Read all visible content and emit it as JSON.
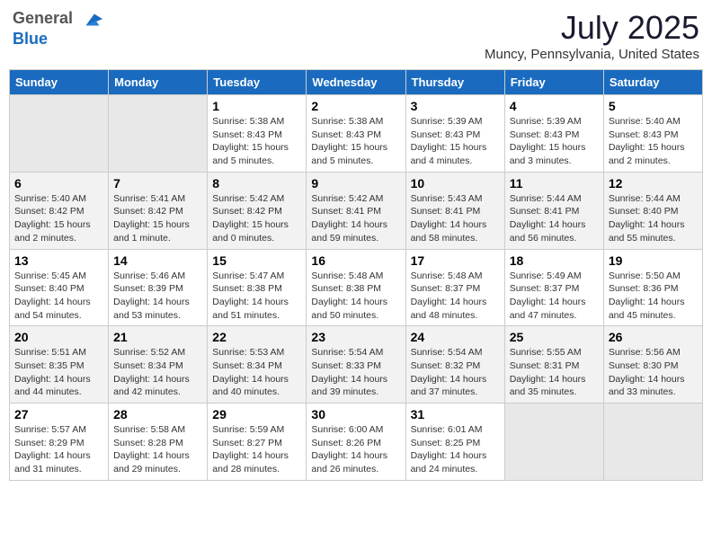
{
  "logo": {
    "general": "General",
    "blue": "Blue"
  },
  "title": {
    "month_year": "July 2025",
    "location": "Muncy, Pennsylvania, United States"
  },
  "headers": [
    "Sunday",
    "Monday",
    "Tuesday",
    "Wednesday",
    "Thursday",
    "Friday",
    "Saturday"
  ],
  "weeks": [
    [
      {
        "day": "",
        "info": ""
      },
      {
        "day": "",
        "info": ""
      },
      {
        "day": "1",
        "info": "Sunrise: 5:38 AM\nSunset: 8:43 PM\nDaylight: 15 hours\nand 5 minutes."
      },
      {
        "day": "2",
        "info": "Sunrise: 5:38 AM\nSunset: 8:43 PM\nDaylight: 15 hours\nand 5 minutes."
      },
      {
        "day": "3",
        "info": "Sunrise: 5:39 AM\nSunset: 8:43 PM\nDaylight: 15 hours\nand 4 minutes."
      },
      {
        "day": "4",
        "info": "Sunrise: 5:39 AM\nSunset: 8:43 PM\nDaylight: 15 hours\nand 3 minutes."
      },
      {
        "day": "5",
        "info": "Sunrise: 5:40 AM\nSunset: 8:43 PM\nDaylight: 15 hours\nand 2 minutes."
      }
    ],
    [
      {
        "day": "6",
        "info": "Sunrise: 5:40 AM\nSunset: 8:42 PM\nDaylight: 15 hours\nand 2 minutes."
      },
      {
        "day": "7",
        "info": "Sunrise: 5:41 AM\nSunset: 8:42 PM\nDaylight: 15 hours\nand 1 minute."
      },
      {
        "day": "8",
        "info": "Sunrise: 5:42 AM\nSunset: 8:42 PM\nDaylight: 15 hours\nand 0 minutes."
      },
      {
        "day": "9",
        "info": "Sunrise: 5:42 AM\nSunset: 8:41 PM\nDaylight: 14 hours\nand 59 minutes."
      },
      {
        "day": "10",
        "info": "Sunrise: 5:43 AM\nSunset: 8:41 PM\nDaylight: 14 hours\nand 58 minutes."
      },
      {
        "day": "11",
        "info": "Sunrise: 5:44 AM\nSunset: 8:41 PM\nDaylight: 14 hours\nand 56 minutes."
      },
      {
        "day": "12",
        "info": "Sunrise: 5:44 AM\nSunset: 8:40 PM\nDaylight: 14 hours\nand 55 minutes."
      }
    ],
    [
      {
        "day": "13",
        "info": "Sunrise: 5:45 AM\nSunset: 8:40 PM\nDaylight: 14 hours\nand 54 minutes."
      },
      {
        "day": "14",
        "info": "Sunrise: 5:46 AM\nSunset: 8:39 PM\nDaylight: 14 hours\nand 53 minutes."
      },
      {
        "day": "15",
        "info": "Sunrise: 5:47 AM\nSunset: 8:38 PM\nDaylight: 14 hours\nand 51 minutes."
      },
      {
        "day": "16",
        "info": "Sunrise: 5:48 AM\nSunset: 8:38 PM\nDaylight: 14 hours\nand 50 minutes."
      },
      {
        "day": "17",
        "info": "Sunrise: 5:48 AM\nSunset: 8:37 PM\nDaylight: 14 hours\nand 48 minutes."
      },
      {
        "day": "18",
        "info": "Sunrise: 5:49 AM\nSunset: 8:37 PM\nDaylight: 14 hours\nand 47 minutes."
      },
      {
        "day": "19",
        "info": "Sunrise: 5:50 AM\nSunset: 8:36 PM\nDaylight: 14 hours\nand 45 minutes."
      }
    ],
    [
      {
        "day": "20",
        "info": "Sunrise: 5:51 AM\nSunset: 8:35 PM\nDaylight: 14 hours\nand 44 minutes."
      },
      {
        "day": "21",
        "info": "Sunrise: 5:52 AM\nSunset: 8:34 PM\nDaylight: 14 hours\nand 42 minutes."
      },
      {
        "day": "22",
        "info": "Sunrise: 5:53 AM\nSunset: 8:34 PM\nDaylight: 14 hours\nand 40 minutes."
      },
      {
        "day": "23",
        "info": "Sunrise: 5:54 AM\nSunset: 8:33 PM\nDaylight: 14 hours\nand 39 minutes."
      },
      {
        "day": "24",
        "info": "Sunrise: 5:54 AM\nSunset: 8:32 PM\nDaylight: 14 hours\nand 37 minutes."
      },
      {
        "day": "25",
        "info": "Sunrise: 5:55 AM\nSunset: 8:31 PM\nDaylight: 14 hours\nand 35 minutes."
      },
      {
        "day": "26",
        "info": "Sunrise: 5:56 AM\nSunset: 8:30 PM\nDaylight: 14 hours\nand 33 minutes."
      }
    ],
    [
      {
        "day": "27",
        "info": "Sunrise: 5:57 AM\nSunset: 8:29 PM\nDaylight: 14 hours\nand 31 minutes."
      },
      {
        "day": "28",
        "info": "Sunrise: 5:58 AM\nSunset: 8:28 PM\nDaylight: 14 hours\nand 29 minutes."
      },
      {
        "day": "29",
        "info": "Sunrise: 5:59 AM\nSunset: 8:27 PM\nDaylight: 14 hours\nand 28 minutes."
      },
      {
        "day": "30",
        "info": "Sunrise: 6:00 AM\nSunset: 8:26 PM\nDaylight: 14 hours\nand 26 minutes."
      },
      {
        "day": "31",
        "info": "Sunrise: 6:01 AM\nSunset: 8:25 PM\nDaylight: 14 hours\nand 24 minutes."
      },
      {
        "day": "",
        "info": ""
      },
      {
        "day": "",
        "info": ""
      }
    ]
  ]
}
